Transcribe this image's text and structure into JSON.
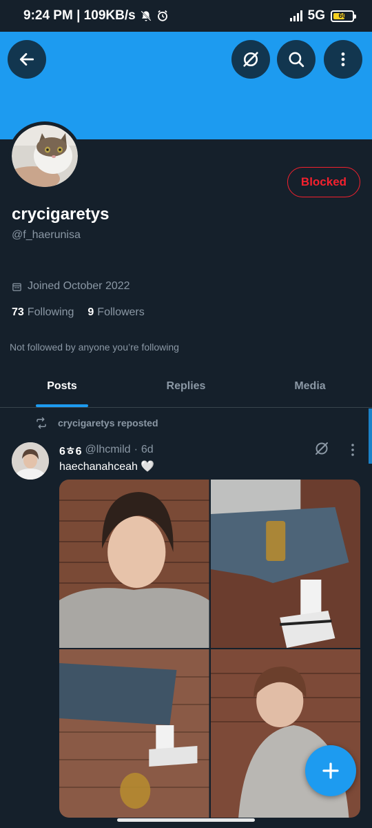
{
  "status_bar": {
    "time_speed": "9:24 PM | 109KB/s",
    "network": "5G",
    "battery": "60",
    "battery_level": 0.6
  },
  "header": {
    "back_icon": "arrow-left-icon",
    "grok_icon": "grok-icon",
    "search_icon": "search-icon",
    "more_icon": "more-vertical-icon"
  },
  "profile": {
    "display_name": "crycigaretys",
    "handle": "@f_haerunisa",
    "blocked_label": "Blocked",
    "joined": "Joined October 2022",
    "following_count": "73",
    "following_label": "Following",
    "followers_count": "9",
    "followers_label": "Followers",
    "not_followed": "Not followed by anyone you’re following"
  },
  "tabs": [
    {
      "label": "Posts",
      "active": true
    },
    {
      "label": "Replies",
      "active": false
    },
    {
      "label": "Media",
      "active": false
    }
  ],
  "tweet": {
    "repost_label": "crycigaretys reposted",
    "author_name": "6ㅎ6",
    "author_handle": "@lhcmild",
    "separator": "·",
    "age": "6d",
    "text": "haechanahceah 🤍"
  },
  "colors": {
    "background": "#15202b",
    "accent": "#1d9bf0",
    "blocked": "#f4212e",
    "muted": "#8b98a5"
  }
}
